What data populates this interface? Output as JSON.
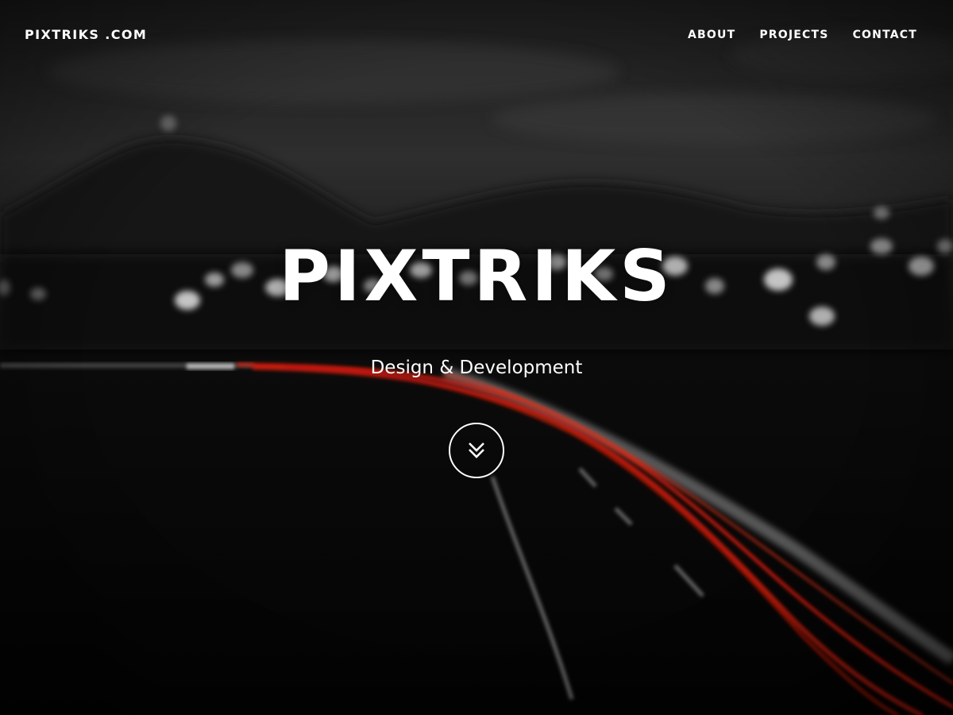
{
  "nav": {
    "brand": "PIXTRIKS .COM",
    "items": [
      {
        "label": "ABOUT"
      },
      {
        "label": "PROJECTS"
      },
      {
        "label": "CONTACT"
      }
    ]
  },
  "hero": {
    "title": "PIXTRIKS",
    "subtitle": "Design & Development",
    "scroll_icon": "double-chevron-down-icon"
  },
  "colors": {
    "text": "#ffffff",
    "light_trail": "#e0200e",
    "background": "#050505"
  }
}
